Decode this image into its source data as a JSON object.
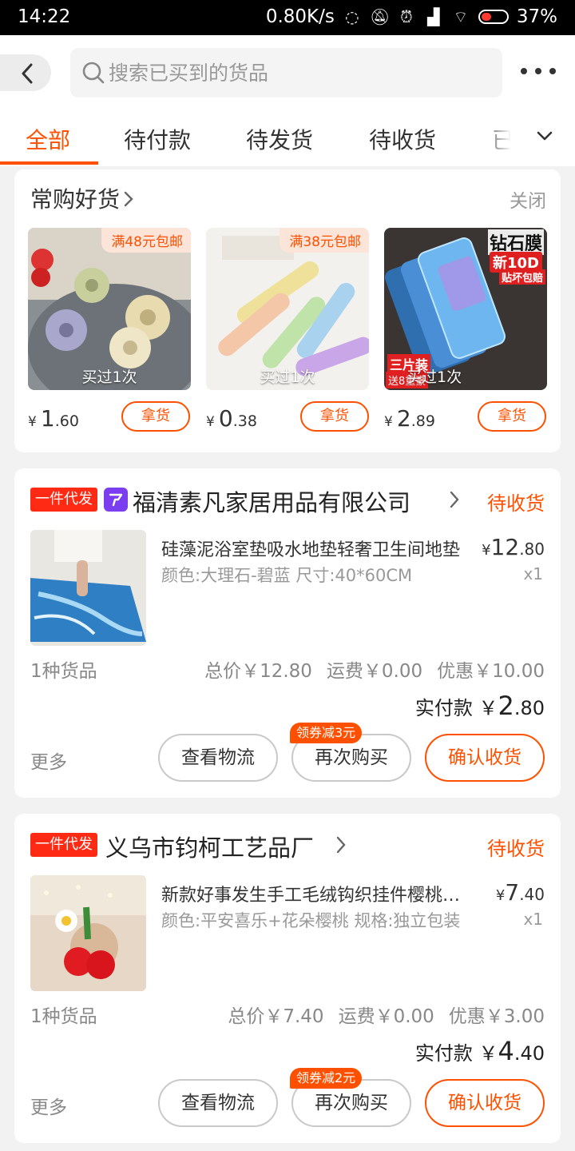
{
  "status_bar": {
    "time": "14:22",
    "speed": "0.80K/s",
    "battery": "37%"
  },
  "header": {
    "search_placeholder": "搜索已买到的货品"
  },
  "tabs": [
    {
      "label": "全部",
      "active": true
    },
    {
      "label": "待付款",
      "active": false
    },
    {
      "label": "待发货",
      "active": false
    },
    {
      "label": "待收货",
      "active": false
    },
    {
      "label": "已",
      "active": false
    }
  ],
  "frequent": {
    "title": "常购好货",
    "close_label": "关闭",
    "items": [
      {
        "badge": "满48元包邮",
        "bought": "买过1次",
        "price_currency": "¥",
        "price_int": "1",
        "price_dec": ".60",
        "button": "拿货"
      },
      {
        "badge": "满38元包邮",
        "bought": "买过1次",
        "price_currency": "¥",
        "price_int": "0",
        "price_dec": ".38",
        "button": "拿货"
      },
      {
        "badge": "",
        "bought": "买过1次",
        "price_currency": "¥",
        "price_int": "2",
        "price_dec": ".89",
        "button": "拿货",
        "image_text": [
          "钻石膜",
          "新10D",
          "贴坏包赔",
          "三片装",
          "送8重豪"
        ]
      }
    ]
  },
  "orders": [
    {
      "tag": "一件代发",
      "shop": "福清素凡家居用品有限公司",
      "status": "待收货",
      "product_title": "硅藻泥浴室垫吸水地垫轻奢卫生间地垫",
      "product_spec": "颜色:大理石-碧蓝 尺寸:40*60CM",
      "price_currency": "¥",
      "price_int": "12",
      "price_dec": ".80",
      "qty": "x1",
      "count_label": "1种货品",
      "total": "总价￥12.80",
      "shipping": "运费￥0.00",
      "discount": "优惠￥10.00",
      "paid_label": "实付款",
      "paid_currency": "￥",
      "paid_int": "2",
      "paid_dec": ".80",
      "more": "更多",
      "btn_logistics": "查看物流",
      "btn_rebuy": "再次购买",
      "btn_confirm": "确认收货",
      "coupon": "领券减3元"
    },
    {
      "tag": "一件代发",
      "shop": "义乌市钧柯工艺品厂",
      "status": "待收货",
      "product_title": "新款好事发生手工毛绒钩织挂件樱桃钥匙扣",
      "product_spec": "颜色:平安喜乐+花朵樱桃 规格:独立包装",
      "price_currency": "¥",
      "price_int": "7",
      "price_dec": ".40",
      "qty": "x1",
      "count_label": "1种货品",
      "total": "总价￥7.40",
      "shipping": "运费￥0.00",
      "discount": "优惠￥3.00",
      "paid_label": "实付款",
      "paid_currency": "￥",
      "paid_int": "4",
      "paid_dec": ".40",
      "more": "更多",
      "btn_logistics": "查看物流",
      "btn_rebuy": "再次购买",
      "btn_confirm": "确认收货",
      "coupon": "领券减2元"
    }
  ],
  "colors": {
    "accent": "#ff5000",
    "tag_red": "#ff2a14",
    "background": "#f2f2f2"
  }
}
